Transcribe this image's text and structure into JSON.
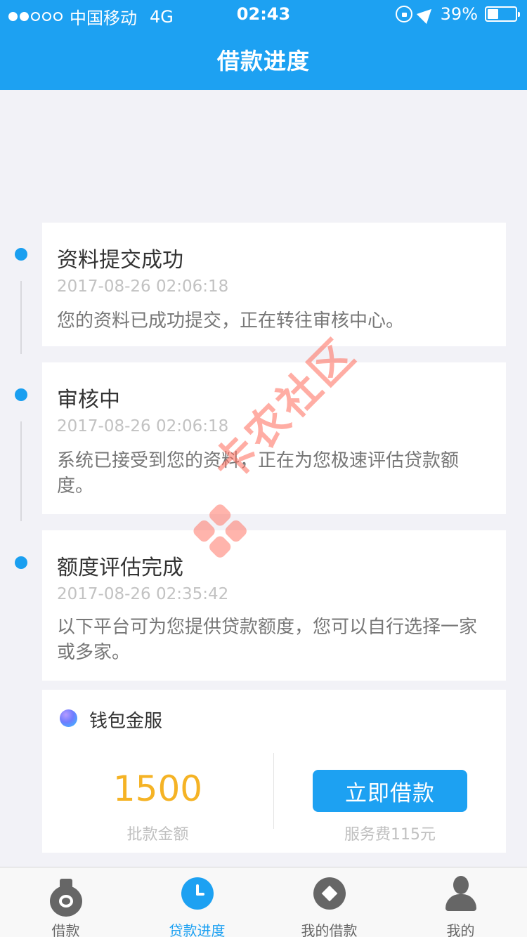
{
  "status_bar": {
    "carrier": "中国移动",
    "network": "4G",
    "time": "02:43",
    "battery_percent": "39%",
    "battery_level": 0.39,
    "signal_bars": 2
  },
  "nav": {
    "title": "借款进度"
  },
  "timeline": [
    {
      "title": "资料提交成功",
      "time": "2017-08-26 02:06:18",
      "desc": "您的资料已成功提交，正在转往审核中心。"
    },
    {
      "title": "审核中",
      "time": "2017-08-26 02:06:18",
      "desc": "系统已接受到您的资料，正在为您极速评估贷款额度。"
    },
    {
      "title": "额度评估完成",
      "time": "2017-08-26 02:35:42",
      "desc": "以下平台可为您提供贷款额度，您可以自行选择一家或多家。"
    }
  ],
  "offer": {
    "brand": "钱包金服",
    "amount": "1500",
    "amount_label": "批款金额",
    "button_label": "立即借款",
    "fee": "服务费115元"
  },
  "watermark": "卡农社区",
  "tabs": [
    {
      "label": "借款",
      "icon": "medal-icon",
      "active": false
    },
    {
      "label": "贷款进度",
      "icon": "clock-icon",
      "active": true
    },
    {
      "label": "我的借款",
      "icon": "diamond-icon",
      "active": false
    },
    {
      "label": "我的",
      "icon": "person-icon",
      "active": false
    }
  ],
  "colors": {
    "brand_blue": "#1da1f2",
    "amount_orange": "#f5b325",
    "page_bg": "#f2f2f7"
  }
}
